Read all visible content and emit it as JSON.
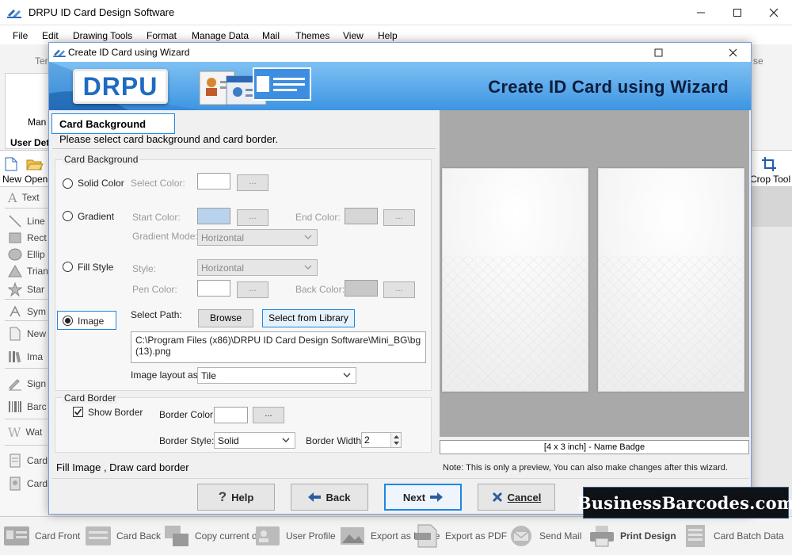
{
  "main_window": {
    "title": "DRPU ID Card Design Software",
    "menu": [
      "File",
      "Edit",
      "Drawing Tools",
      "Format",
      "Manage Data",
      "Mail",
      "Themes",
      "View",
      "Help"
    ],
    "ribbon": {
      "left_fragment_1": "Ter",
      "left_fragment_2": "Man",
      "left_fragment_3": "User Det",
      "right_fragment": "se"
    },
    "toolbar": {
      "new_label": "New",
      "open_label": "Open",
      "crop_tool_label": "Crop Tool"
    },
    "sidebar_items": [
      "Text",
      "Line",
      "Rect",
      "Ellip",
      "Trian",
      "Star",
      "Sym",
      "New",
      "Ima",
      "Sign",
      "Barc",
      "Wat",
      "Card",
      "Card"
    ],
    "bottom_bar": [
      {
        "label": "Card Front",
        "icon": "card-front-icon"
      },
      {
        "label": "Card Back",
        "icon": "card-back-icon"
      },
      {
        "label": "Copy current design",
        "icon": "copy-design-icon"
      },
      {
        "label": "User Profile",
        "icon": "user-profile-icon"
      },
      {
        "label": "Export as Image",
        "icon": "export-image-icon"
      },
      {
        "label": "Export as PDF",
        "icon": "export-pdf-icon"
      },
      {
        "label": "Send Mail",
        "icon": "send-mail-icon"
      },
      {
        "label": "Print Design",
        "icon": "printer-icon"
      },
      {
        "label": "Card Batch Data",
        "icon": "batch-data-icon"
      }
    ]
  },
  "dialog": {
    "title": "Create ID Card using Wizard",
    "banner_title": "Create ID Card using Wizard",
    "logo_text": "DRPU",
    "section_title": "Card Background",
    "section_subtitle": "Please select card background and card border.",
    "bg_group": {
      "legend": "Card Background",
      "solid_color": {
        "label": "Solid Color",
        "select_color_label": "Select Color:",
        "dots": "..."
      },
      "gradient": {
        "label": "Gradient",
        "start_color_label": "Start Color:",
        "end_color_label": "End Color:",
        "mode_label": "Gradient Mode:",
        "mode_value": "Horizontal",
        "dots": "..."
      },
      "fill_style": {
        "label": "Fill Style",
        "style_label": "Style:",
        "style_value": "Horizontal",
        "pen_color_label": "Pen Color:",
        "back_color_label": "Back Color:",
        "dots": "..."
      },
      "image": {
        "label": "Image",
        "select_path_label": "Select Path:",
        "browse_label": "Browse",
        "library_label": "Select from Library",
        "path_value": "C:\\Program Files (x86)\\DRPU ID Card Design Software\\Mini_BG\\bg (13).png",
        "layout_label": "Image layout as:",
        "layout_value": "Tile"
      },
      "selected": "image"
    },
    "border_group": {
      "legend": "Card Border",
      "show_border_label": "Show Border",
      "show_border_checked": true,
      "border_color_label": "Border Color:",
      "border_style_label": "Border Style:",
      "border_style_value": "Solid",
      "border_width_label": "Border Width:",
      "border_width_value": "2",
      "dots": "..."
    },
    "preview": {
      "size_label": "[4 x 3 inch] - Name Badge",
      "note": "Note: This is only a preview, You can also make changes after this wizard."
    },
    "status_text": "Fill Image , Draw card border",
    "buttons": {
      "help": "Help",
      "back": "Back",
      "next": "Next",
      "cancel": "Cancel"
    }
  },
  "watermark": "BusinessBarcodes.com",
  "colors": {
    "accent": "#1e88e5",
    "banner_top": "#7ec1f3",
    "banner_bottom": "#3d95e3",
    "gradient_start": "#b9d3ee",
    "end_color": "#d6d6d6",
    "back_color": "#c8c8c8",
    "preview_bg": "#a9a9a9"
  }
}
